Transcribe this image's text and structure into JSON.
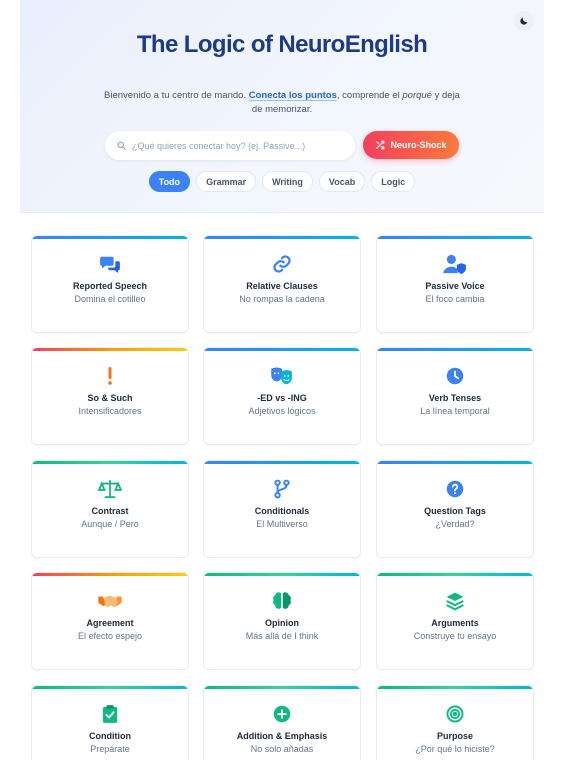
{
  "header": {
    "title": "The Logic of NeuroEnglish",
    "subtitle_pre": "Bienvenido a tu centro de mando.",
    "subtitle_link": "Conecta los puntos",
    "subtitle_mid": ", comprende el",
    "subtitle_em": "porqué",
    "subtitle_post": "y deja de memorizar.",
    "theme_icon": "moon-icon"
  },
  "search": {
    "placeholder": "¿Qué quieres conectar hoy? (ej. Passive...)",
    "value": ""
  },
  "shock_button": {
    "label": "Neuro-Shock",
    "icon": "shuffle-icon"
  },
  "filters": [
    {
      "label": "Todo",
      "active": true
    },
    {
      "label": "Grammar",
      "active": false
    },
    {
      "label": "Writing",
      "active": false
    },
    {
      "label": "Vocab",
      "active": false
    },
    {
      "label": "Logic",
      "active": false
    }
  ],
  "colors": {
    "accent_blue": "#3b82f6",
    "accent_green": "#10b981",
    "accent_orange": "#f97316",
    "shock_gradient": [
      "#f43f5e",
      "#fb7a3c"
    ]
  },
  "cards": [
    {
      "title": "Reported Speech",
      "subtitle": "Domina el cotilleo",
      "icon": "chat-bubbles-icon",
      "icon_color": "#3b82f6",
      "bar": "blue"
    },
    {
      "title": "Relative Clauses",
      "subtitle": "No rompas la cadena",
      "icon": "link-icon",
      "icon_color": "#3b82f6",
      "bar": "blue"
    },
    {
      "title": "Passive Voice",
      "subtitle": "El foco cambia",
      "icon": "user-shield-icon",
      "icon_color": "#3b82f6",
      "bar": "blue"
    },
    {
      "title": "So & Such",
      "subtitle": "Intensificadores",
      "icon": "exclamation-icon",
      "icon_color": "#f97316",
      "bar": "warm"
    },
    {
      "title": "-ED vs -ING",
      "subtitle": "Adjetivos lógicos",
      "icon": "theater-masks-icon",
      "icon_color": "#3b82f6",
      "bar": "blue"
    },
    {
      "title": "Verb Tenses",
      "subtitle": "La línea temporal",
      "icon": "clock-icon",
      "icon_color": "#3b82f6",
      "bar": "blue"
    },
    {
      "title": "Contrast",
      "subtitle": "Aunque / Pero",
      "icon": "balance-scale-icon",
      "icon_color": "#10b981",
      "bar": "green"
    },
    {
      "title": "Conditionals",
      "subtitle": "El Multiverso",
      "icon": "code-branch-icon",
      "icon_color": "#3b82f6",
      "bar": "blue"
    },
    {
      "title": "Question Tags",
      "subtitle": "¿Verdad?",
      "icon": "question-circle-icon",
      "icon_color": "#3b82f6",
      "bar": "blue"
    },
    {
      "title": "Agreement",
      "subtitle": "El efecto espejo",
      "icon": "handshake-icon",
      "icon_color": "#f97316",
      "bar": "warm"
    },
    {
      "title": "Opinion",
      "subtitle": "Más allá de I think",
      "icon": "brain-icon",
      "icon_color": "#10b981",
      "bar": "green"
    },
    {
      "title": "Arguments",
      "subtitle": "Construye tu ensayo",
      "icon": "layers-icon",
      "icon_color": "#10b981",
      "bar": "green"
    },
    {
      "title": "Condition",
      "subtitle": "Prepárate",
      "icon": "clipboard-check-icon",
      "icon_color": "#10b981",
      "bar": "green"
    },
    {
      "title": "Addition & Emphasis",
      "subtitle": "No solo añadas",
      "icon": "plus-circle-icon",
      "icon_color": "#10b981",
      "bar": "green"
    },
    {
      "title": "Purpose",
      "subtitle": "¿Por qué lo hiciste?",
      "icon": "target-icon",
      "icon_color": "#10b981",
      "bar": "green"
    }
  ]
}
